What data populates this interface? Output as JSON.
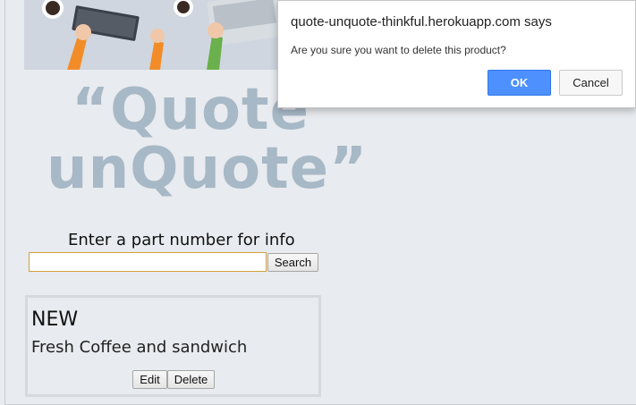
{
  "dialog": {
    "title": "quote-unquote-thinkful.herokuapp.com says",
    "message": "Are you sure you want to delete this product?",
    "ok_label": "OK",
    "cancel_label": "Cancel"
  },
  "logo": {
    "line1": "“Quote",
    "line2": "unQuote”"
  },
  "search": {
    "prompt": "Enter a part number for info",
    "value": "",
    "button_label": "Search"
  },
  "product": {
    "title": "NEW",
    "description": "Fresh Coffee and sandwich",
    "edit_label": "Edit",
    "delete_label": "Delete"
  },
  "colors": {
    "page_bg": "#e8ebef",
    "logo_text": "#a7b8c6",
    "ok_button": "#4d90fe",
    "input_border": "#d49f3a"
  }
}
